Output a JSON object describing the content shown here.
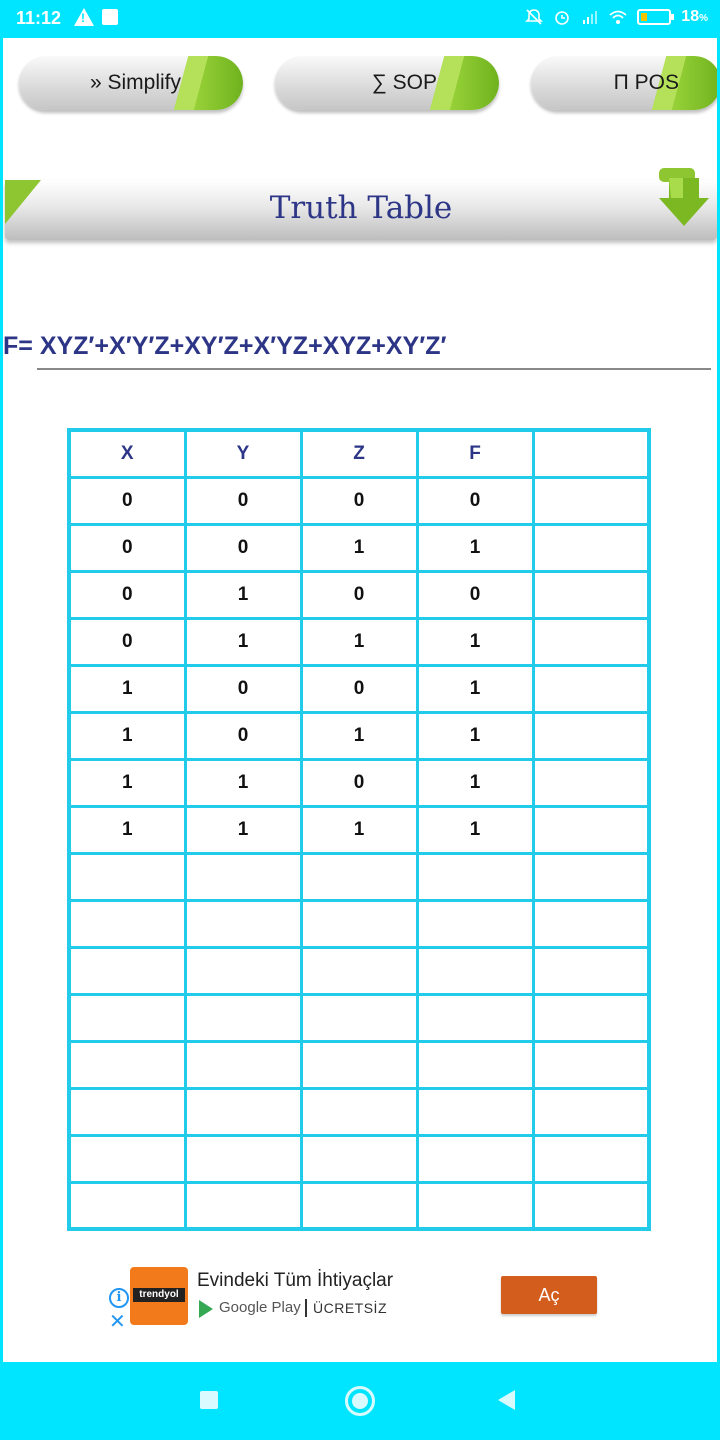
{
  "status_bar": {
    "time": "11:12",
    "battery": "18",
    "battery_unit": "%",
    "icons": [
      "warning-icon",
      "notification-square-icon",
      "mute-icon",
      "alarm-icon",
      "signal-icon",
      "wifi-icon",
      "battery-icon"
    ]
  },
  "toolbar": {
    "simplify_label": "» Simplify",
    "sop_label": "∑ SOP",
    "pos_label": "Π POS",
    "accent_color": "#8dc630"
  },
  "section": {
    "title": "Truth Table"
  },
  "expression": "F= XYZ′+X′Y′Z+XY′Z+X′YZ+XYZ+XY′Z′",
  "truth_table": {
    "headers": [
      "X",
      "Y",
      "Z",
      "F",
      ""
    ],
    "rows": [
      [
        "0",
        "0",
        "0",
        "0",
        ""
      ],
      [
        "0",
        "0",
        "1",
        "1",
        ""
      ],
      [
        "0",
        "1",
        "0",
        "0",
        ""
      ],
      [
        "0",
        "1",
        "1",
        "1",
        ""
      ],
      [
        "1",
        "0",
        "0",
        "1",
        ""
      ],
      [
        "1",
        "0",
        "1",
        "1",
        ""
      ],
      [
        "1",
        "1",
        "0",
        "1",
        ""
      ],
      [
        "1",
        "1",
        "1",
        "1",
        ""
      ],
      [
        "",
        "",
        "",
        "",
        ""
      ],
      [
        "",
        "",
        "",
        "",
        ""
      ],
      [
        "",
        "",
        "",
        "",
        ""
      ],
      [
        "",
        "",
        "",
        "",
        ""
      ],
      [
        "",
        "",
        "",
        "",
        ""
      ],
      [
        "",
        "",
        "",
        "",
        ""
      ],
      [
        "",
        "",
        "",
        "",
        ""
      ],
      [
        "",
        "",
        "",
        "",
        ""
      ]
    ],
    "border_color": "#22cbea"
  },
  "ad": {
    "logo_text": "trendyol",
    "headline": "Evindeki Tüm İhtiyaçlar",
    "store": "Google Play",
    "price": "ÜCRETSİZ",
    "cta": "Aç"
  },
  "colors": {
    "system_bar": "#00e5ff",
    "heading": "#2d3586"
  }
}
